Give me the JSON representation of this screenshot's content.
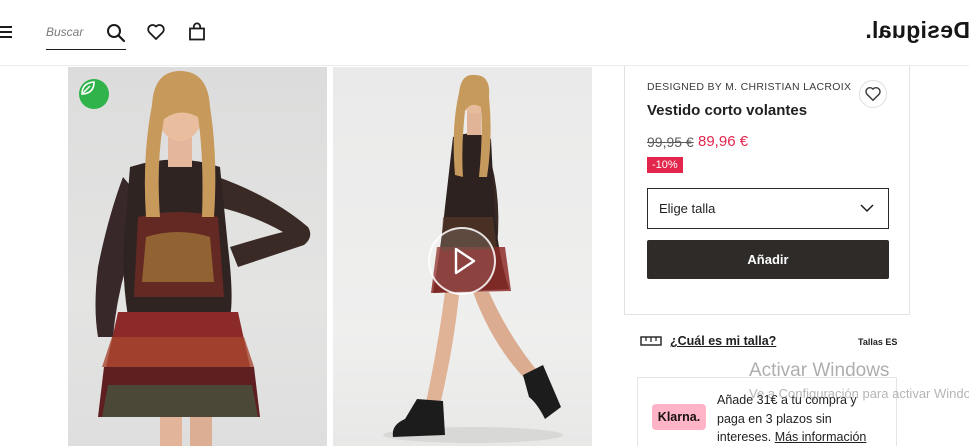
{
  "header": {
    "menu_icon": "hamburger-menu-icon",
    "search_placeholder": "Buscar",
    "search_icon": "search-icon",
    "wishlist_icon": "heart-icon",
    "cart_icon": "shopping-bag-icon",
    "logo_text": "Desigual."
  },
  "gallery": {
    "badge_icon": "leaf-icon",
    "badge_color": "#2fb34a",
    "video_icon": "play-icon"
  },
  "product": {
    "designer": "DESIGNED BY M. CHRISTIAN LACROIX",
    "title": "Vestido corto volantes",
    "price_old": "99,95 €",
    "price_new": "89,96 €",
    "discount": "-10%",
    "sale_color": "#e3264c",
    "size_select_label": "Elige talla",
    "add_button_label": "Añadir",
    "wishlist_icon": "heart-icon"
  },
  "size_guide": {
    "icon": "ruler-icon",
    "link_text": "¿Cuál es mi talla?",
    "region": "Tallas ES"
  },
  "klarna": {
    "logo_text": "Klarna.",
    "logo_color": "#ffb3c7",
    "text": "Añade 31€ a tu compra y paga en 3 plazos sin intereses.",
    "link_text": "Más información"
  },
  "watermark": {
    "title": "Activar Windows",
    "subtitle": "Ve a Configuración para activar Windows."
  }
}
